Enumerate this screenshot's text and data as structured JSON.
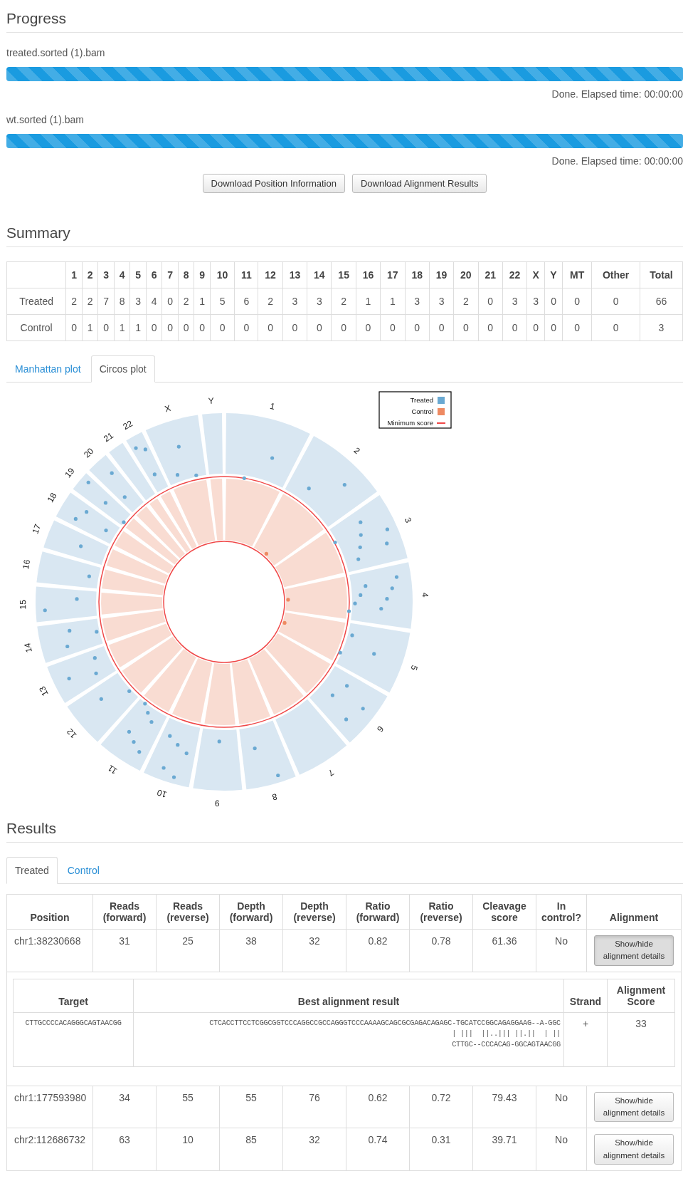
{
  "progress": {
    "title": "Progress",
    "files": [
      {
        "name": "treated.sorted (1).bam",
        "level": 1,
        "status": "Done. Elapsed time: 00:00:00"
      },
      {
        "name": "wt.sorted (1).bam",
        "level": 1,
        "status": "Done. Elapsed time: 00:00:00"
      }
    ]
  },
  "downloads": [
    "Download Position Information",
    "Download Alignment Results"
  ],
  "summary": {
    "title": "Summary",
    "columns": [
      "1",
      "2",
      "3",
      "4",
      "5",
      "6",
      "7",
      "8",
      "9",
      "10",
      "11",
      "12",
      "13",
      "14",
      "15",
      "16",
      "17",
      "18",
      "19",
      "20",
      "21",
      "22",
      "X",
      "Y",
      "MT",
      "Other",
      "Total"
    ],
    "rows": [
      {
        "label": "Treated",
        "values": [
          "2",
          "2",
          "7",
          "8",
          "3",
          "4",
          "0",
          "2",
          "1",
          "5",
          "6",
          "2",
          "3",
          "3",
          "2",
          "1",
          "1",
          "3",
          "3",
          "2",
          "0",
          "3",
          "3",
          "0",
          "0",
          "0",
          "66"
        ]
      },
      {
        "label": "Control",
        "values": [
          "0",
          "1",
          "0",
          "1",
          "1",
          "0",
          "0",
          "0",
          "0",
          "0",
          "0",
          "0",
          "0",
          "0",
          "0",
          "0",
          "0",
          "0",
          "0",
          "0",
          "0",
          "0",
          "0",
          "0",
          "0",
          "0",
          "3"
        ]
      }
    ]
  },
  "plot_tabs": [
    {
      "label": "Manhattan plot",
      "selected": false
    },
    {
      "label": "Circos plot",
      "selected": true
    }
  ],
  "circos": {
    "chromosomes": [
      "1",
      "2",
      "3",
      "4",
      "5",
      "6",
      "7",
      "8",
      "9",
      "10",
      "11",
      "12",
      "13",
      "14",
      "15",
      "16",
      "17",
      "18",
      "19",
      "20",
      "21",
      "22",
      "X",
      "Y"
    ],
    "legend": [
      {
        "label": "Treated",
        "kind": "swatch",
        "color": "#6aa9d2"
      },
      {
        "label": "Control",
        "kind": "swatch",
        "color": "#ee8a62"
      },
      {
        "label": "Minimum score",
        "kind": "line",
        "color": "#f04848"
      }
    ]
  },
  "results": {
    "title": "Results",
    "tabs": [
      {
        "label": "Treated",
        "selected": true
      },
      {
        "label": "Control",
        "selected": false
      }
    ],
    "columns": [
      "Position",
      "Reads (forward)",
      "Reads (reverse)",
      "Depth (forward)",
      "Depth (reverse)",
      "Ratio (forward)",
      "Ratio (reverse)",
      "Cleavage score",
      "In control?",
      "Alignment"
    ],
    "rows": [
      {
        "cells": [
          "chr1:38230668",
          "31",
          "25",
          "38",
          "32",
          "0.82",
          "0.78",
          "61.36",
          "No"
        ],
        "action": "Show/hide alignment details",
        "expanded": true,
        "details": {
          "columns": [
            "Target",
            "Best alignment result",
            "Strand",
            "Alignment Score"
          ],
          "target": "CTTGCCCCACAGGGCAGTAACGG",
          "alignment": [
            "CTCACCTTCCTCGGCGGTCCCAGGCCGCCAGGGTCCCAAAAGCAGCGCGAGACAGAGC-TGCATCCGGCAGAGGAAG--A-GGC",
            "| |||  ||..||| ||.||  | ||",
            "CTTGC--CCCACAG-GGCAGTAACGG"
          ],
          "strand": "+",
          "score": "33"
        }
      },
      {
        "cells": [
          "chr1:177593980",
          "34",
          "55",
          "55",
          "76",
          "0.62",
          "0.72",
          "79.43",
          "No"
        ],
        "action": "Show/hide alignment details",
        "expanded": false
      },
      {
        "cells": [
          "chr2:112686732",
          "63",
          "10",
          "85",
          "32",
          "0.74",
          "0.31",
          "39.71",
          "No"
        ],
        "action": "Show/hide alignment details",
        "expanded": false
      }
    ]
  }
}
